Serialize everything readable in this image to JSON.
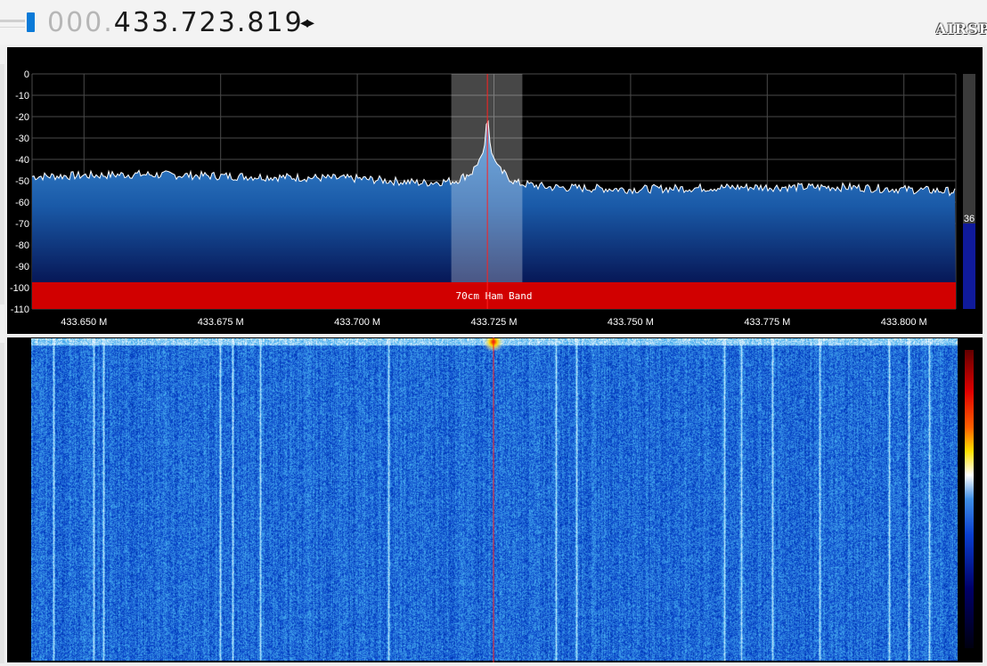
{
  "header": {
    "frequency_leading": "000.",
    "frequency_value": "433.723.819",
    "frequency_arrows": "◂▸",
    "logo_text": "AIRSPY"
  },
  "spectrum": {
    "y_axis_ticks": [
      "0",
      "-10",
      "-20",
      "-30",
      "-40",
      "-50",
      "-60",
      "-70",
      "-80",
      "-90",
      "-100",
      "-110"
    ],
    "x_axis_ticks": [
      "433.650 M",
      "433.675 M",
      "433.700 M",
      "433.725 M",
      "433.750 M",
      "433.775 M",
      "433.800 M"
    ],
    "band_label": "70cm Ham Band",
    "band_color": "#d10000",
    "gain_value": "36",
    "colors": {
      "fill_top": "#3f8fd6",
      "fill_bottom": "#00004a",
      "trace": "#ffffff",
      "grid": "#4a4a4a",
      "cursor": "#ff2020"
    },
    "chart_data": {
      "type": "area",
      "x_unit": "MHz",
      "y_unit": "dB",
      "xlim": [
        433.6405,
        433.8095
      ],
      "ylim": [
        -110,
        0
      ],
      "x": [
        433.6405,
        433.66,
        433.68,
        433.7,
        433.712,
        433.718,
        433.721,
        433.7232,
        433.7238,
        433.7244,
        433.726,
        433.729,
        433.735,
        433.75,
        433.77,
        433.79,
        433.8095
      ],
      "values": [
        -48,
        -47,
        -48,
        -49,
        -51,
        -50,
        -46,
        -36,
        -18,
        -36,
        -45,
        -51,
        -53,
        -54,
        -53,
        -53,
        -55
      ],
      "grid": true
    }
  },
  "waterfall": {
    "palette": [
      "#000010",
      "#00006a",
      "#0a3fcf",
      "#3f8fe6",
      "#ffffff",
      "#ffe100",
      "#ff6000",
      "#e00000",
      "#640000"
    ]
  }
}
